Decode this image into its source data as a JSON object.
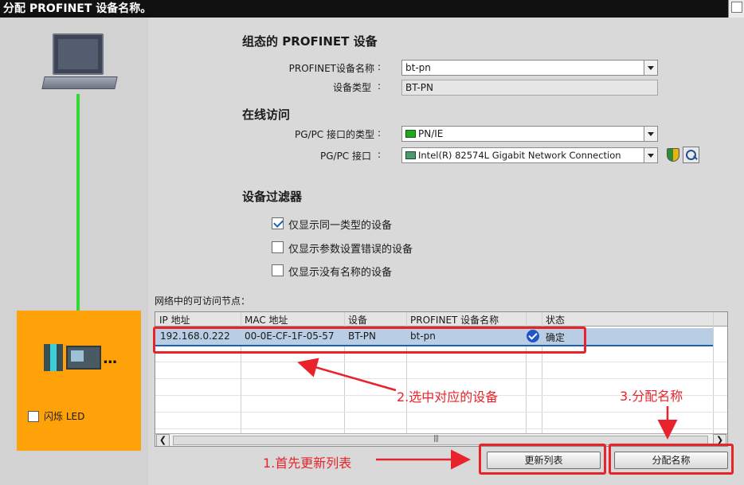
{
  "window": {
    "title": "分配 PROFINET 设备名称。"
  },
  "left_pane": {
    "flash_led_label": "闪烁 LED"
  },
  "configured_device": {
    "section_title": "组态的 PROFINET 设备",
    "name_label": "PROFINET设备名称",
    "name_value": "bt-pn",
    "type_label": "设备类型",
    "type_value": "BT-PN"
  },
  "online_access": {
    "section_title": "在线访问",
    "interface_type_label": "PG/PC 接口的类型",
    "interface_type_value": "PN/IE",
    "interface_label": "PG/PC 接口",
    "interface_value": "Intel(R) 82574L Gigabit Network Connection"
  },
  "device_filter": {
    "section_title": "设备过滤器",
    "options": [
      {
        "label": "仅显示同一类型的设备",
        "checked": true
      },
      {
        "label": "仅显示参数设置错误的设备",
        "checked": false
      },
      {
        "label": "仅显示没有名称的设备",
        "checked": false
      }
    ]
  },
  "nodes": {
    "caption": "网络中的可访问节点：",
    "columns": [
      "IP 地址",
      "MAC 地址",
      "设备",
      "PROFINET 设备名称",
      "状态"
    ],
    "rows": [
      {
        "ip": "192.168.0.222",
        "mac": "00-0E-CF-1F-05-57",
        "device": "BT-PN",
        "name": "bt-pn",
        "status": "确定"
      }
    ]
  },
  "buttons": {
    "update_list": "更新列表",
    "assign_name": "分配名称"
  },
  "annotations": {
    "step1": "1.首先更新列表",
    "step2": "2.选中对应的设备",
    "step3": "3.分配名称"
  },
  "colors": {
    "annotation_red": "#e8232b",
    "device_box_orange": "#ffa20a",
    "connection_green": "#33d933"
  }
}
